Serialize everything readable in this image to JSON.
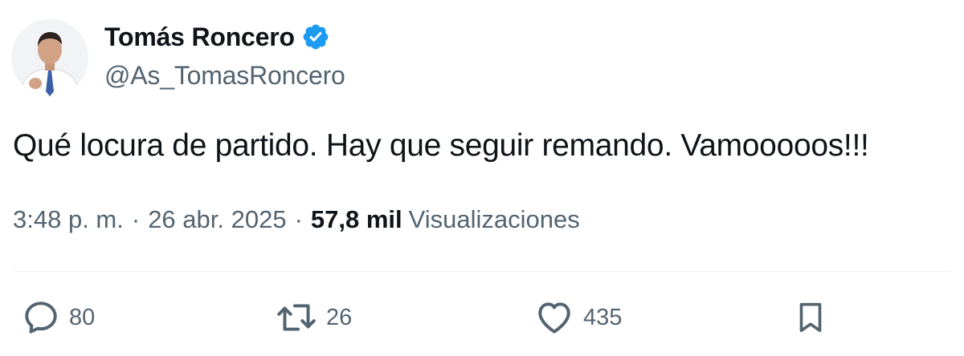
{
  "author": {
    "display_name": "Tomás Roncero",
    "handle": "@As_TomasRoncero",
    "verified": true,
    "verified_color": "#1d9bf0",
    "avatar_icon": "profile-photo"
  },
  "tweet": {
    "text": "Qué locura de partido. Hay que seguir remando. Vamooooos!!!"
  },
  "meta": {
    "time": "3:48 p. m.",
    "separator": "·",
    "date": "26 abr. 2025",
    "views_count": "57,8 mil",
    "views_label": "Visualizaciones"
  },
  "actions": {
    "replies": "80",
    "retweets": "26",
    "likes": "435",
    "icons": [
      "reply-icon",
      "retweet-icon",
      "like-icon",
      "bookmark-icon"
    ]
  },
  "colors": {
    "text_primary": "#0f1419",
    "text_secondary": "#536471",
    "divider": "#eff3f4"
  }
}
